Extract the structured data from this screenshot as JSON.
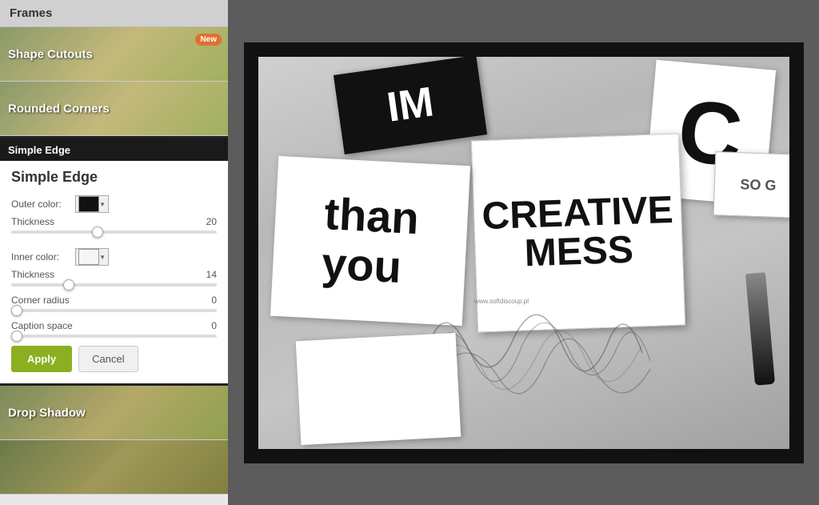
{
  "sidebar": {
    "title": "Frames",
    "items": [
      {
        "id": "shape-cutouts",
        "label": "Shape Cutouts",
        "badge": "New",
        "has_badge": true
      },
      {
        "id": "rounded-corners",
        "label": "Rounded Corners",
        "has_badge": false
      },
      {
        "id": "simple-edge",
        "label": "Simple Edge",
        "has_badge": false,
        "active": true
      },
      {
        "id": "drop-shadow",
        "label": "Drop Shadow",
        "has_badge": false
      }
    ]
  },
  "simple_edge_panel": {
    "title": "Simple Edge",
    "outer_color_label": "Outer color:",
    "outer_color": "#111111",
    "outer_thickness_label": "Thickness",
    "outer_thickness_value": 20,
    "outer_slider_pct": 42,
    "inner_color_label": "Inner color:",
    "inner_color": "#f5f5f5",
    "inner_thickness_label": "Thickness",
    "inner_thickness_value": 14,
    "inner_slider_pct": 28,
    "corner_radius_label": "Corner radius",
    "corner_radius_value": 0,
    "corner_slider_pct": 0,
    "caption_space_label": "Caption space",
    "caption_space_value": 0,
    "caption_slider_pct": 0,
    "apply_label": "Apply",
    "cancel_label": "Cancel"
  },
  "photo": {
    "alt": "Black and white creative mess photo with typography cards"
  }
}
